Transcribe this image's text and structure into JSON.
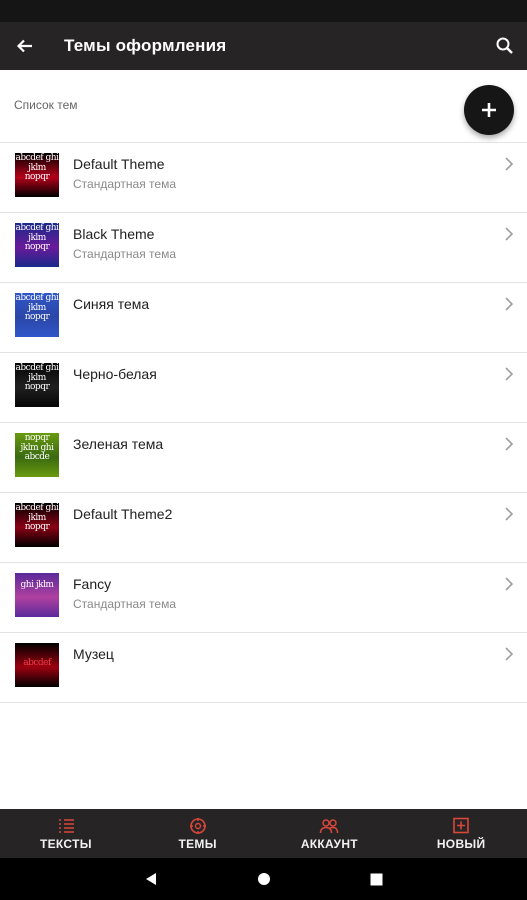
{
  "appbar": {
    "title": "Темы оформления",
    "back_icon": "arrow-left-icon",
    "search_icon": "search-icon"
  },
  "subheader": {
    "label": "Список тем"
  },
  "fab": {
    "icon": "plus-icon"
  },
  "themes": [
    {
      "title": "Default Theme",
      "subtitle": "Стандартная тема",
      "thumb_text": "abcdef ghi jklm nopqr",
      "colors": [
        "#000000",
        "#b5001a"
      ]
    },
    {
      "title": "Black Theme",
      "subtitle": "Стандартная тема",
      "thumb_text": "abcdef ghi jklm nopqr",
      "colors": [
        "#1a2a8a",
        "#6a1a9a"
      ]
    },
    {
      "title": "Синяя тема",
      "subtitle": "",
      "thumb_text": "abcdef ghi jklm nopqr",
      "colors": [
        "#2f56c8",
        "#2b47a8"
      ]
    },
    {
      "title": "Черно-белая",
      "subtitle": "",
      "thumb_text": "abcdef ghi jklm nopqr",
      "colors": [
        "#050505",
        "#202020"
      ]
    },
    {
      "title": "Зеленая тема",
      "subtitle": "",
      "thumb_text": "nopqr jklm ghi abcde",
      "colors": [
        "#6a9a10",
        "#3a6a10"
      ]
    },
    {
      "title": "Default Theme2",
      "subtitle": "",
      "thumb_text": "abcdef ghi jklm nopqr",
      "colors": [
        "#000000",
        "#8a0014"
      ]
    },
    {
      "title": "Fancy",
      "subtitle": "Стандартная тема",
      "thumb_text": "ghi jklm",
      "colors": [
        "#5a2a9a",
        "#b040a0"
      ]
    },
    {
      "title": "Музец",
      "subtitle": "",
      "thumb_text": "abcdef",
      "colors": [
        "#000000",
        "#9a0010"
      ]
    }
  ],
  "bottom_nav": [
    {
      "label": "ТЕКСТЫ",
      "icon": "list-icon",
      "accent": "#d9463a"
    },
    {
      "label": "ТЕМЫ",
      "icon": "palette-icon",
      "accent": "#d9463a"
    },
    {
      "label": "АККАУНТ",
      "icon": "people-icon",
      "accent": "#d9463a"
    },
    {
      "label": "НОВЫЙ",
      "icon": "add-box-icon",
      "accent": "#d9463a"
    }
  ],
  "colors": {
    "appbar": "#262424",
    "accent": "#d9463a",
    "fab": "#161616"
  }
}
